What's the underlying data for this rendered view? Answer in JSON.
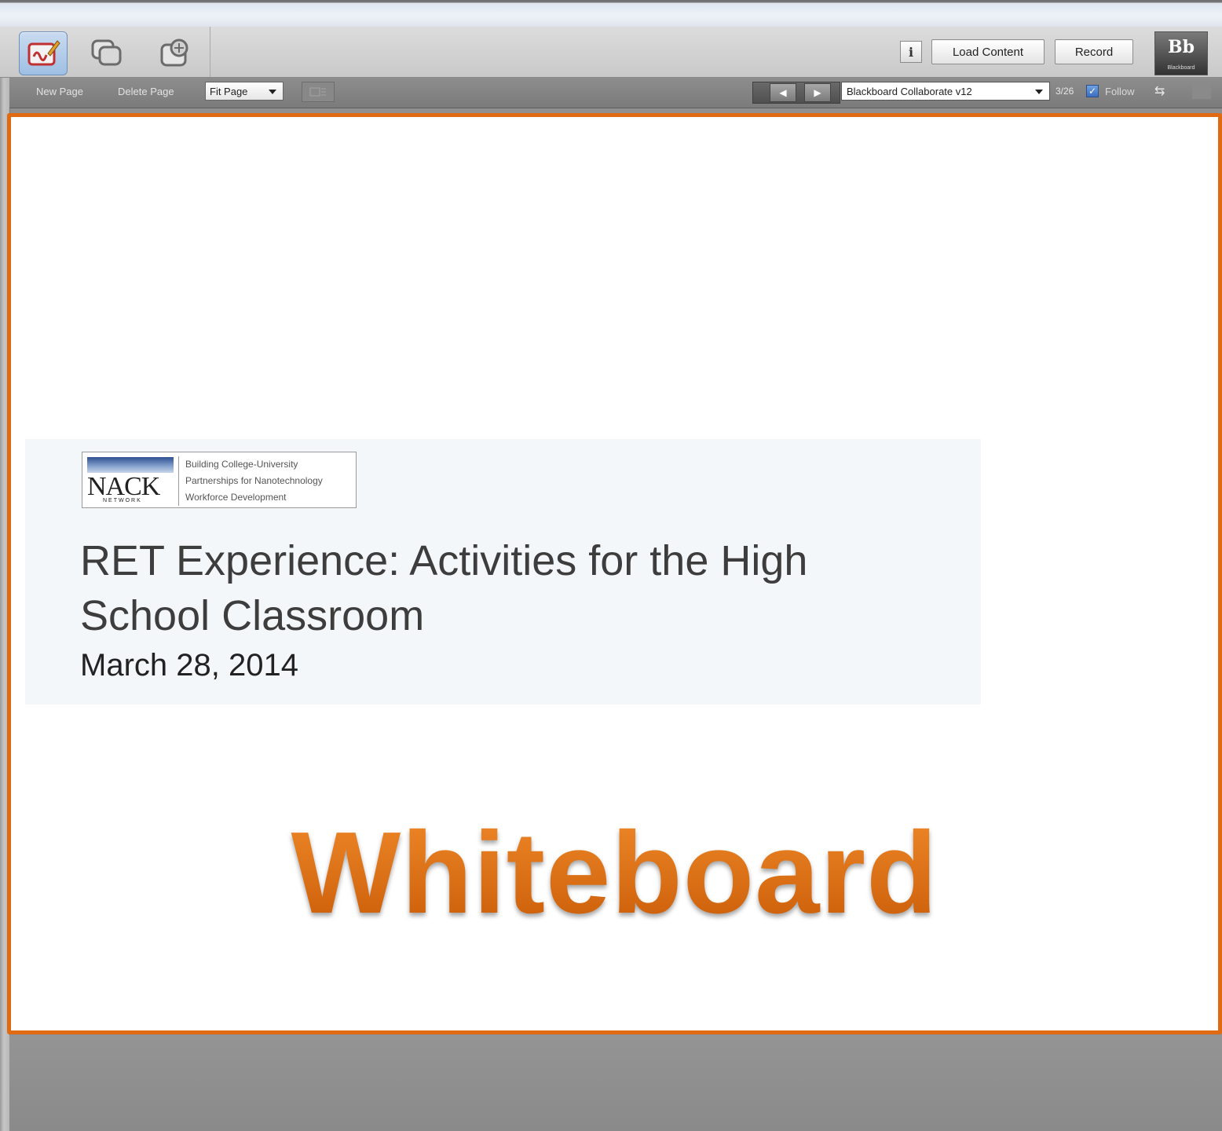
{
  "toolbar": {
    "modes": [
      {
        "name": "whiteboard-mode",
        "icon": "whiteboard-pen-icon",
        "active": true
      },
      {
        "name": "application-sharing-mode",
        "icon": "app-share-icon",
        "active": false
      },
      {
        "name": "web-tour-mode",
        "icon": "web-tour-icon",
        "active": false
      }
    ],
    "info_label": "i",
    "load_content_label": "Load Content",
    "record_label": "Record",
    "logo": {
      "letters": "Bb",
      "caption": "Blackboard"
    }
  },
  "subbar": {
    "new_page_label": "New Page",
    "delete_page_label": "Delete Page",
    "fit_select_value": "Fit Page",
    "prev_icon": "◀",
    "next_icon": "▶",
    "slide_select_value": "Blackboard Collaborate v12",
    "page_count": "3/26",
    "follow_checked": true,
    "follow_check_glyph": "✓",
    "follow_label": "Follow",
    "swap_icon_glyph": "⇆"
  },
  "slide": {
    "logo_text": "NACK",
    "logo_subtext": "NETWORK",
    "tagline": [
      "Building College-University",
      "Partnerships for Nanotechnology",
      "Workforce Development"
    ],
    "title": "RET Experience: Activities for the High School Classroom",
    "date": "March 28, 2014"
  },
  "overlay_label": "Whiteboard",
  "colors": {
    "accent_orange": "#e06a11",
    "toolbar_gray": "#c9c9c9",
    "subbar_gray": "#7b7b7b"
  }
}
